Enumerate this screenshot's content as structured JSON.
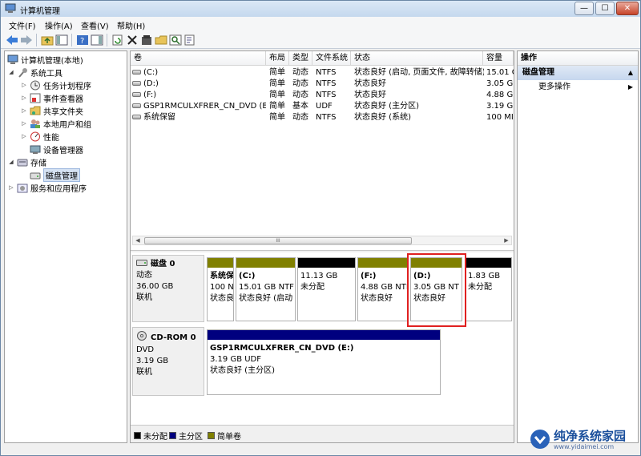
{
  "window": {
    "title": "计算机管理",
    "buttons": {
      "minimize": "—",
      "maximize": "☐",
      "close": "✕"
    }
  },
  "menubar": {
    "items": [
      "文件(F)",
      "操作(A)",
      "查看(V)",
      "帮助(H)"
    ]
  },
  "toolbar": {
    "icons": [
      "back-arrow-icon",
      "forward-arrow-icon",
      "up-folder-icon",
      "show-hide-tree-icon",
      "help-icon",
      "show-hide-action-icon",
      "refresh-icon",
      "delete-icon",
      "properties-icon",
      "open-folder-icon",
      "search-icon",
      "export-icon"
    ]
  },
  "tree": {
    "root": "计算机管理(本地)",
    "system_tools": "系统工具",
    "task_scheduler": "任务计划程序",
    "event_viewer": "事件查看器",
    "shared_folders": "共享文件夹",
    "local_users": "本地用户和组",
    "performance": "性能",
    "device_manager": "设备管理器",
    "storage": "存储",
    "disk_management": "磁盘管理",
    "services_apps": "服务和应用程序"
  },
  "volume_list": {
    "headers": [
      "卷",
      "布局",
      "类型",
      "文件系统",
      "状态",
      "容量"
    ],
    "rows": [
      [
        "(C:)",
        "简单",
        "动态",
        "NTFS",
        "状态良好 (启动, 页面文件, 故障转储)",
        "15.01 G"
      ],
      [
        "(D:)",
        "简单",
        "动态",
        "NTFS",
        "状态良好",
        "3.05 GI"
      ],
      [
        "(F:)",
        "简单",
        "动态",
        "NTFS",
        "状态良好",
        "4.88 GI"
      ],
      [
        "GSP1RMCULXFRER_CN_DVD (E:)",
        "简单",
        "基本",
        "UDF",
        "状态良好 (主分区)",
        "3.19 GI"
      ],
      [
        "系统保留",
        "简单",
        "动态",
        "NTFS",
        "状态良好 (系统)",
        "100 MI"
      ]
    ],
    "scroll_grip": "III"
  },
  "disks": {
    "disk0": {
      "name": "磁盘 0",
      "type": "动态",
      "size": "36.00 GB",
      "status": "联机",
      "partitions": [
        {
          "name": "系统保",
          "size": "100 N",
          "status": "状态良",
          "bar_color": "#808000"
        },
        {
          "name": "(C:)",
          "size": "15.01 GB NTF",
          "status": "状态良好 (启动",
          "bar_color": "#808000"
        },
        {
          "name": "",
          "size": "11.13 GB",
          "status": "未分配",
          "bar_color": "#000000"
        },
        {
          "name": "(F:)",
          "size": "4.88 GB NTI",
          "status": "状态良好",
          "bar_color": "#808000"
        },
        {
          "name": "(D:)",
          "size": "3.05 GB NT",
          "status": "状态良好",
          "bar_color": "#808000"
        },
        {
          "name": "",
          "size": "1.83 GB",
          "status": "未分配",
          "bar_color": "#000000"
        }
      ]
    },
    "cdrom0": {
      "name": "CD-ROM 0",
      "type": "DVD",
      "size": "3.19 GB",
      "status": "联机",
      "partition": {
        "name": "GSP1RMCULXFRER_CN_DVD  (E:)",
        "size": "3.19 GB UDF",
        "status": "状态良好 (主分区)",
        "bar_color": "#00007f"
      }
    }
  },
  "legend": [
    {
      "label": "未分配",
      "color": "#000000"
    },
    {
      "label": "主分区",
      "color": "#00007f"
    },
    {
      "label": "简单卷",
      "color": "#808000"
    }
  ],
  "actions": {
    "header": "操作",
    "section": "磁盘管理",
    "more": "更多操作"
  },
  "watermark": {
    "text": "纯净系统家园",
    "url": "www.yidaimei.com"
  }
}
